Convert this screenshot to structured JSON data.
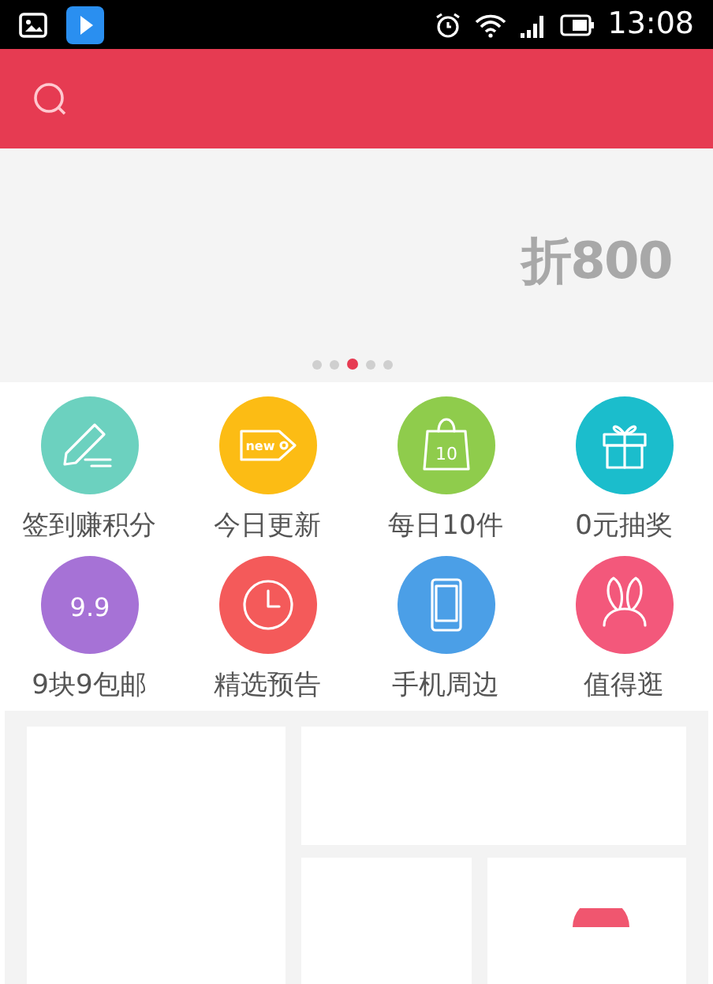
{
  "status_bar": {
    "time": "13:08"
  },
  "banner": {
    "logo": "折800",
    "dots": [
      {
        "selected": false
      },
      {
        "selected": false
      },
      {
        "selected": true
      },
      {
        "selected": false
      },
      {
        "selected": false
      }
    ]
  },
  "categories": [
    {
      "label": "签到赚积分",
      "kind": "pencil",
      "color": "#6cd1bf"
    },
    {
      "label": "今日更新",
      "kind": "tag",
      "color": "#fcbc14",
      "icon_text": "new"
    },
    {
      "label": "每日10件",
      "kind": "bag",
      "color": "#8fcc4c",
      "icon_text": "10"
    },
    {
      "label": "0元抽奖",
      "kind": "gift",
      "color": "#1bbdcc"
    },
    {
      "label": "9块9包邮",
      "kind": "number",
      "color": "#a672d6",
      "icon_text": "9.9"
    },
    {
      "label": "精选预告",
      "kind": "clock",
      "color": "#f45a5a"
    },
    {
      "label": "手机周边",
      "kind": "phone",
      "color": "#4b9fe7"
    },
    {
      "label": "值得逛",
      "kind": "ears",
      "color": "#f3587b"
    }
  ]
}
